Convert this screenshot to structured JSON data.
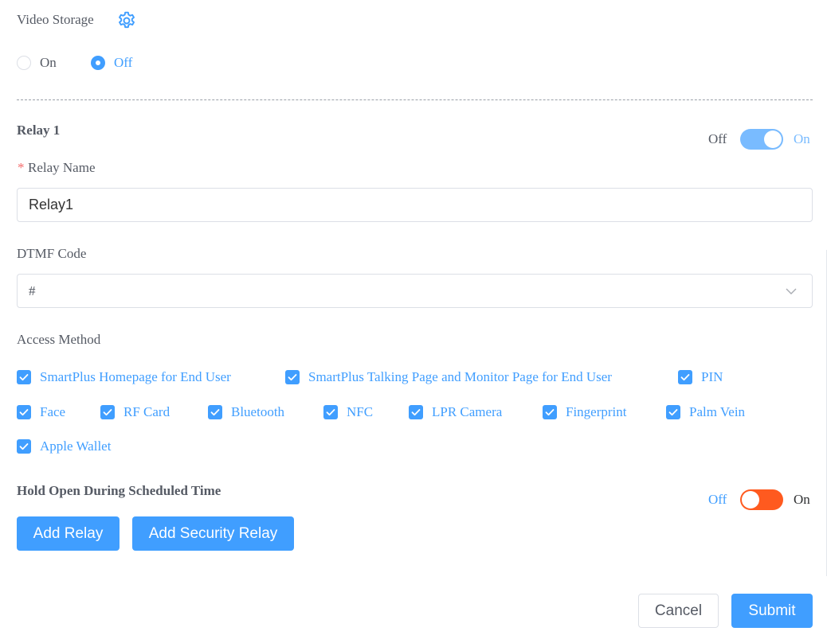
{
  "video_storage": {
    "title": "Video Storage",
    "options": {
      "on": "On",
      "off": "Off"
    },
    "selected": "off"
  },
  "relay": {
    "title": "Relay 1",
    "switch": {
      "off": "Off",
      "on": "On",
      "state": "on",
      "color": "#79bbff"
    },
    "name_required_mark": "*",
    "name_label": "Relay Name",
    "name_value": "Relay1",
    "dtmf_label": "DTMF Code",
    "dtmf_value": "#",
    "access_label": "Access Method",
    "access_methods": [
      "SmartPlus Homepage for End User",
      "SmartPlus Talking Page and Monitor Page for End User",
      "PIN",
      "Face",
      "RF Card",
      "Bluetooth",
      "NFC",
      "LPR Camera",
      "Fingerprint",
      "Palm Vein",
      "Apple Wallet"
    ],
    "hold_open": {
      "title": "Hold Open During Scheduled Time",
      "off": "Off",
      "on": "On",
      "state": "off",
      "color": "#ff5a1f"
    }
  },
  "buttons": {
    "add_relay": "Add Relay",
    "add_security_relay": "Add Security Relay",
    "cancel": "Cancel",
    "submit": "Submit"
  },
  "colors": {
    "accent": "#409eff",
    "required": "#f56c6c"
  }
}
